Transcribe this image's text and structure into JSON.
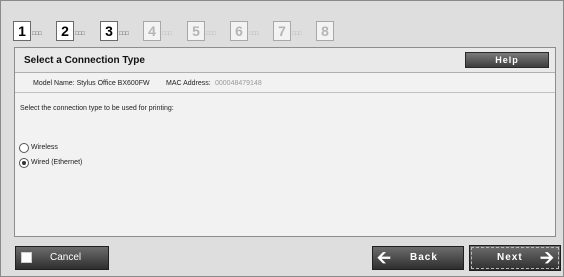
{
  "steps": [
    {
      "number": "1",
      "active": true
    },
    {
      "number": "2",
      "active": true
    },
    {
      "number": "3",
      "active": true
    },
    {
      "number": "4",
      "active": false
    },
    {
      "number": "5",
      "active": false
    },
    {
      "number": "6",
      "active": false
    },
    {
      "number": "7",
      "active": false
    },
    {
      "number": "8",
      "active": false
    }
  ],
  "step_dots": "□□□",
  "panel": {
    "title": "Select a Connection Type",
    "help_label": "Help",
    "model_label": "Model Name: Stylus Office BX600FW",
    "mac_label": "MAC Address:",
    "mac_value": "000048479148",
    "instruction": "Select the connection type to be used for printing:"
  },
  "options": [
    {
      "label": "Wireless",
      "selected": false
    },
    {
      "label": "Wired (Ethernet)",
      "selected": true
    }
  ],
  "buttons": {
    "cancel_label": "Cancel",
    "back_label": "Back",
    "next_label": "Next"
  },
  "icons": {
    "back": "arrow-left-icon",
    "next": "arrow-right-icon"
  }
}
